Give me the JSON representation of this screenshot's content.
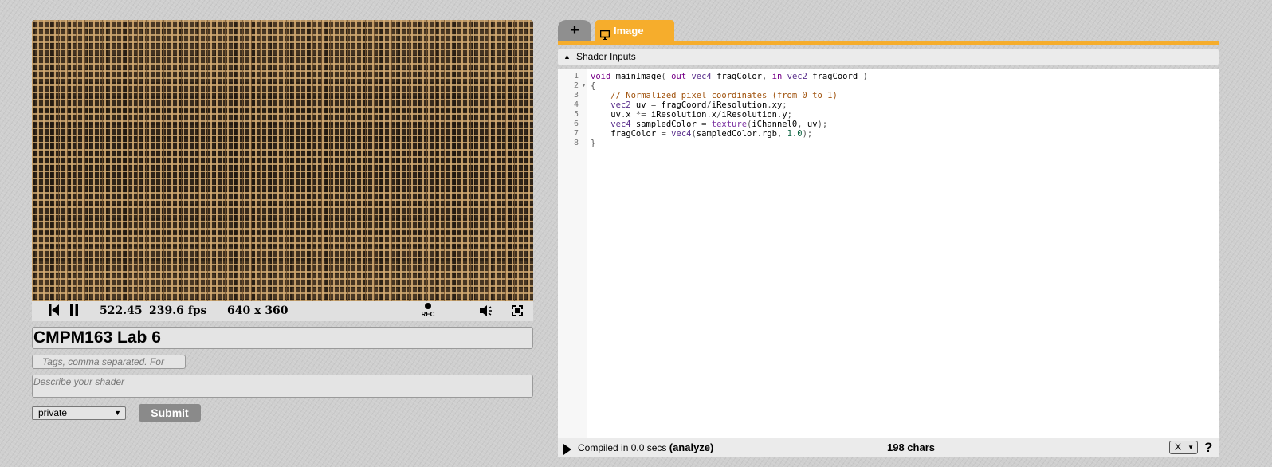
{
  "player": {
    "time": "522.45",
    "fps": "239.6 fps",
    "resolution": "640 x 360",
    "rec_label": "REC"
  },
  "form": {
    "title_value": "CMPM163 Lab 6",
    "tags_placeholder": "Tags, comma separated. For",
    "description_placeholder": "Describe your shader",
    "privacy_selected": "private",
    "submit_label": "Submit"
  },
  "editor": {
    "add_tab_label": "+",
    "active_tab_label": "Image",
    "shader_inputs_label": "Shader Inputs",
    "line_numbers": [
      "1",
      "2",
      "3",
      "4",
      "5",
      "6",
      "7",
      "8"
    ],
    "code_lines": [
      "void mainImage( out vec4 fragColor, in vec2 fragCoord )",
      "{",
      "    // Normalized pixel coordinates (from 0 to 1)",
      "    vec2 uv = fragCoord/iResolution.xy;",
      "    uv.x *= iResolution.x/iResolution.y;",
      "    vec4 sampledColor = texture(iChannel0, uv);",
      "    fragColor = vec4(sampledColor.rgb, 1.0);",
      "}"
    ]
  },
  "status": {
    "compiled_text": "Compiled in 0.0 secs",
    "analyze_label": "(analyze)",
    "chars": "198 chars",
    "x_selector": "X",
    "help": "?"
  },
  "colors": {
    "accent": "#f6ad2c",
    "submit_bg": "#8a8a8a"
  }
}
